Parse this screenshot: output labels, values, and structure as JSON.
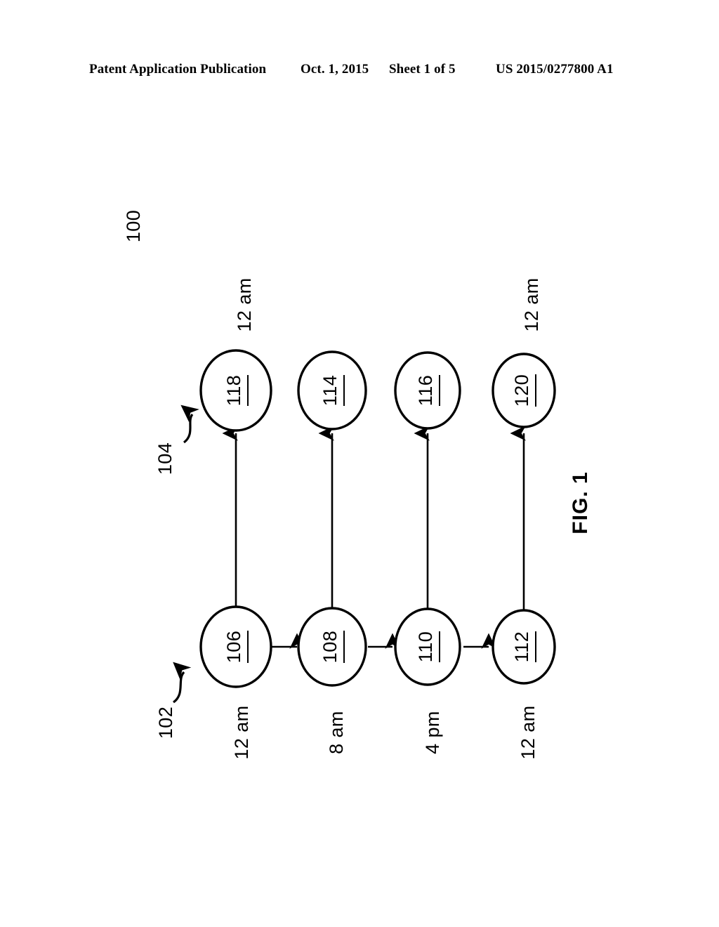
{
  "header": {
    "publication": "Patent Application Publication",
    "date": "Oct. 1, 2015",
    "sheet": "Sheet 1 of 5",
    "patent_number": "US 2015/0277800 A1"
  },
  "figure": {
    "caption": "FIG. 1",
    "diagram_ref": "100",
    "group_refs": [
      {
        "id": "ref-102",
        "label": "102",
        "points_to": "106"
      },
      {
        "id": "ref-104",
        "label": "104",
        "points_to": "118"
      }
    ],
    "bottom_row": {
      "nodes": [
        {
          "id": "106",
          "label": "106",
          "time": "12 am"
        },
        {
          "id": "108",
          "label": "108",
          "time": "8 am"
        },
        {
          "id": "110",
          "label": "110",
          "time": "4 pm"
        },
        {
          "id": "112",
          "label": "112",
          "time": "12 am"
        }
      ]
    },
    "top_row": {
      "nodes": [
        {
          "id": "118",
          "label": "118",
          "time": "12 am"
        },
        {
          "id": "114",
          "label": "114",
          "time": ""
        },
        {
          "id": "116",
          "label": "116",
          "time": ""
        },
        {
          "id": "120",
          "label": "120",
          "time": "12 am"
        }
      ]
    },
    "colors": {
      "ink": "#000000",
      "background": "#ffffff"
    }
  }
}
